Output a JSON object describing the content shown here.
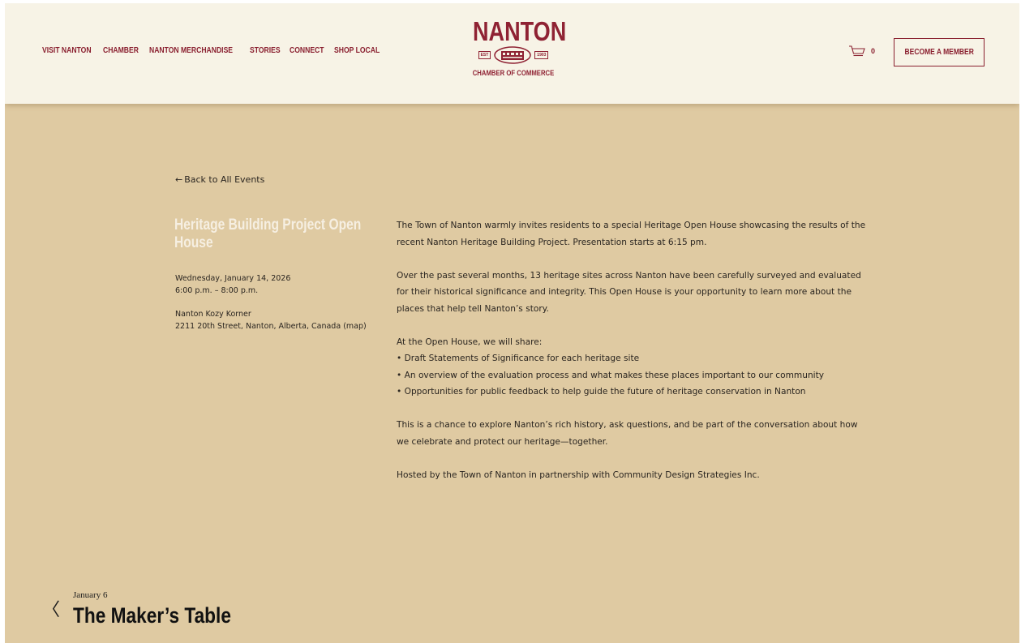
{
  "nav": {
    "items": [
      "VISIT NANTON",
      "CHAMBER",
      "NANTON MERCHANDISE",
      "STORIES",
      "CONNECT",
      "SHOP LOCAL"
    ]
  },
  "logo": {
    "word": "NANTON",
    "est_tag": "EST",
    "year_tag": "1903",
    "subtitle": "CHAMBER OF COMMERCE"
  },
  "cart": {
    "icon": "cart-icon",
    "count": "0"
  },
  "member_button": {
    "label": "BECOME A MEMBER"
  },
  "back_link": {
    "arrow": "←",
    "label": "Back to All Events"
  },
  "event": {
    "title": "Heritage Building Project Open House",
    "date": "Wednesday, January 14, 2026",
    "time": "6:00 p.m. – 8:00 p.m.",
    "venue": "Nanton Kozy Korner",
    "address": "2211 20th Street, Nanton, Alberta, Canada",
    "map_label": "(map)"
  },
  "description": {
    "p1": "The Town of Nanton warmly invites residents to a special Heritage Open House showcasing the results of the recent Nanton Heritage Building Project. Presentation starts at 6:15 pm.",
    "p2": "Over the past several months, 13 heritage sites across Nanton have been carefully surveyed and evaluated for their historical significance and integrity. This Open House is your opportunity to learn more about the places that help tell Nanton’s story.",
    "p3_intro": "At the Open House, we will share:",
    "bullets": [
      "• Draft Statements of Significance for each heritage site",
      "• An overview of the evaluation process and what makes these places important to our community",
      "• Opportunities for public feedback to help guide the future of heritage conservation in Nanton"
    ],
    "p4": "This is a chance to explore Nanton’s rich history, ask questions, and be part of the conversation about how we celebrate and protect our heritage—together.",
    "p5": "Hosted by the Town of Nanton in partnership with Community Design Strategies Inc."
  },
  "prev_event": {
    "arrow": "〈",
    "date": "January 6",
    "title": "The Maker’s Table"
  },
  "colors": {
    "background": "#dfcaa2",
    "header": "#f7f3e6",
    "brand": "#8a2030",
    "title_text": "#f6efe2"
  }
}
